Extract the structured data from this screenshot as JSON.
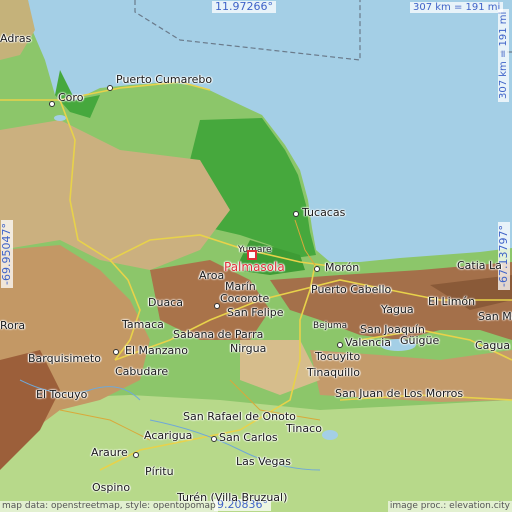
{
  "map": {
    "main_place": "Palmasola",
    "coords": {
      "top_lat": "11.97266°",
      "bottom_lat": "9.20836°",
      "left_lon": "-69.95047°",
      "right_lon": "-67.13797°"
    },
    "scale": {
      "horizontal": "307 km = 191 mi",
      "vertical": "307 km = 191 mi"
    },
    "attribution_left": "map data: openstreetmap, style: opentopomap",
    "attribution_right": "image proc.: elevation.city",
    "places": [
      "Adras",
      "Coro",
      "Puerto Cumarebo",
      "Tucacas",
      "Yumare",
      "Aroa",
      "Marín",
      "Morón",
      "Catia La",
      "Puerto Cabello",
      "El Limón",
      "Cocorote",
      "Duaca",
      "San Felipe",
      "Yagua",
      "San Ma",
      "Tamaca",
      "Sabana de Parra",
      "Bejuma",
      "San Joaquín",
      "Rora",
      "Barquisimeto",
      "El Manzano",
      "Nirgua",
      "Valencia",
      "Güigüe",
      "Cagua",
      "Cabudare",
      "Tocuyito",
      "Tinaquillo",
      "El Tocuyo",
      "San Juan de Los Morros",
      "San Rafael de Onoto",
      "Tinaco",
      "Acarigua",
      "San Carlos",
      "Araure",
      "Las Vegas",
      "Píritu",
      "Ospino",
      "Turén (Villa Bruzual)"
    ],
    "colors": {
      "sea": "#a4cfe6",
      "lowland": "#5fb850",
      "plain": "#a9d486",
      "hills": "#c8a77a",
      "mountain": "#a7714a",
      "coord_text": "#3f63c8",
      "main_marker": "#e0303a"
    }
  }
}
